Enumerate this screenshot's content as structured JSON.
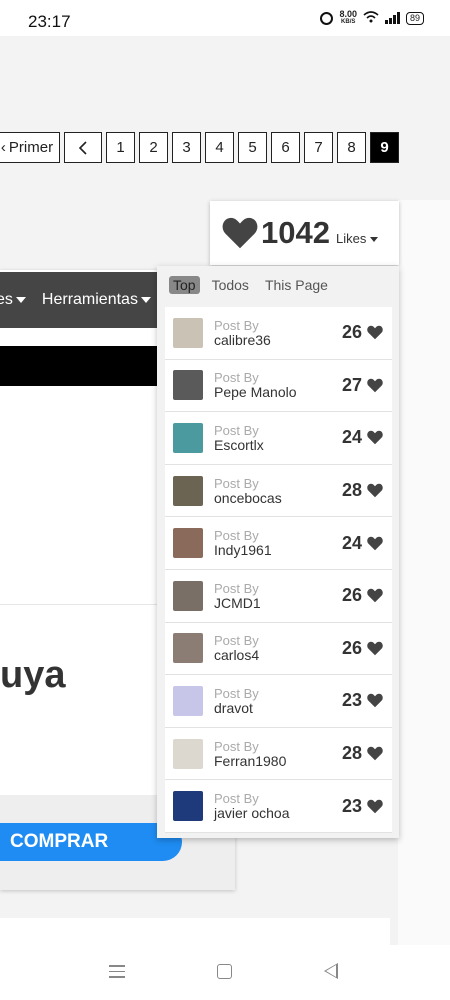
{
  "status_bar": {
    "time": "23:17",
    "speed": "8.00",
    "speed_unit": "KB/S",
    "battery": "89"
  },
  "pagination": {
    "first_label": "Primer",
    "prev_label": "<",
    "pages": [
      "1",
      "2",
      "3",
      "4",
      "5",
      "6",
      "7",
      "8",
      "9"
    ],
    "active_page": "9"
  },
  "navbar": {
    "item_1": "es",
    "item_2": "Herramientas"
  },
  "page": {
    "big_text": "uya",
    "buy_button": "COMPRAR"
  },
  "likes": {
    "count": "1042",
    "label": "Likes",
    "tabs": [
      "Top",
      "Todos",
      "This Page"
    ],
    "active_tab": "Top",
    "post_by_label": "Post By",
    "entries": [
      {
        "user": "calibre36",
        "score": "26",
        "avatar_color": "#c9c2b5"
      },
      {
        "user": "Pepe Manolo",
        "score": "27",
        "avatar_color": "#5a5a5a"
      },
      {
        "user": "Escortlx",
        "score": "24",
        "avatar_color": "#4a9aa0"
      },
      {
        "user": "oncebocas",
        "score": "28",
        "avatar_color": "#6b6452"
      },
      {
        "user": "Indy1961",
        "score": "24",
        "avatar_color": "#8a6a5a"
      },
      {
        "user": "JCMD1",
        "score": "26",
        "avatar_color": "#7a6f66"
      },
      {
        "user": "carlos4",
        "score": "26",
        "avatar_color": "#8c7d74"
      },
      {
        "user": "dravot",
        "score": "23",
        "avatar_color": "#c8c6e8"
      },
      {
        "user": "Ferran1980",
        "score": "28",
        "avatar_color": "#dcd8d0"
      },
      {
        "user": "javier ochoa",
        "score": "23",
        "avatar_color": "#1f3a7a"
      }
    ]
  },
  "colors": {
    "buy_button": "#1e8cf2",
    "nav_bg": "#454545",
    "heart": "#444444"
  }
}
